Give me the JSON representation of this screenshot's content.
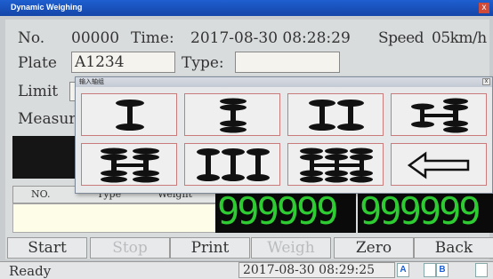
{
  "window": {
    "title": "Dynamic Weighing",
    "close_glyph": "x"
  },
  "header": {
    "no_label": "No.",
    "no_value": "00000",
    "time_label": "Time:",
    "time_value": "2017-08-30 08:28:29",
    "speed_label": "Speed",
    "speed_value": "05km/h"
  },
  "plate": {
    "label": "Plate",
    "value": "A1234"
  },
  "type": {
    "label": "Type:",
    "value": ""
  },
  "limit": {
    "label": "Limit"
  },
  "measure": {
    "label": "Measur"
  },
  "table": {
    "columns": [
      "NO.",
      "Type",
      "Weight"
    ]
  },
  "displays": {
    "left": "999999",
    "right": "999999"
  },
  "buttons": {
    "start": "Start",
    "stop": "Stop",
    "print": "Print",
    "weigh": "Weigh",
    "zero": "Zero",
    "back": "Back"
  },
  "status": {
    "text": "Ready",
    "datetime": "2017-08-30 08:29:25",
    "icons": [
      {
        "name": "indicator-a-icon",
        "text": "A"
      },
      {
        "name": "indicator-b-icon",
        "text": "B"
      },
      {
        "name": "indicator-c-icon",
        "text": ""
      }
    ]
  },
  "axle_dialog": {
    "title": "输入轴组",
    "close_glyph": "x",
    "options": [
      "axle-1-single-icon",
      "axle-1-double-tyre-icon",
      "axle-2-single-icon",
      "axle-2-mixed-icon",
      "axle-3-mixed-icon",
      "axle-3-single-icon",
      "axle-3-double-tyre-icon",
      "backspace-arrow-icon"
    ]
  }
}
